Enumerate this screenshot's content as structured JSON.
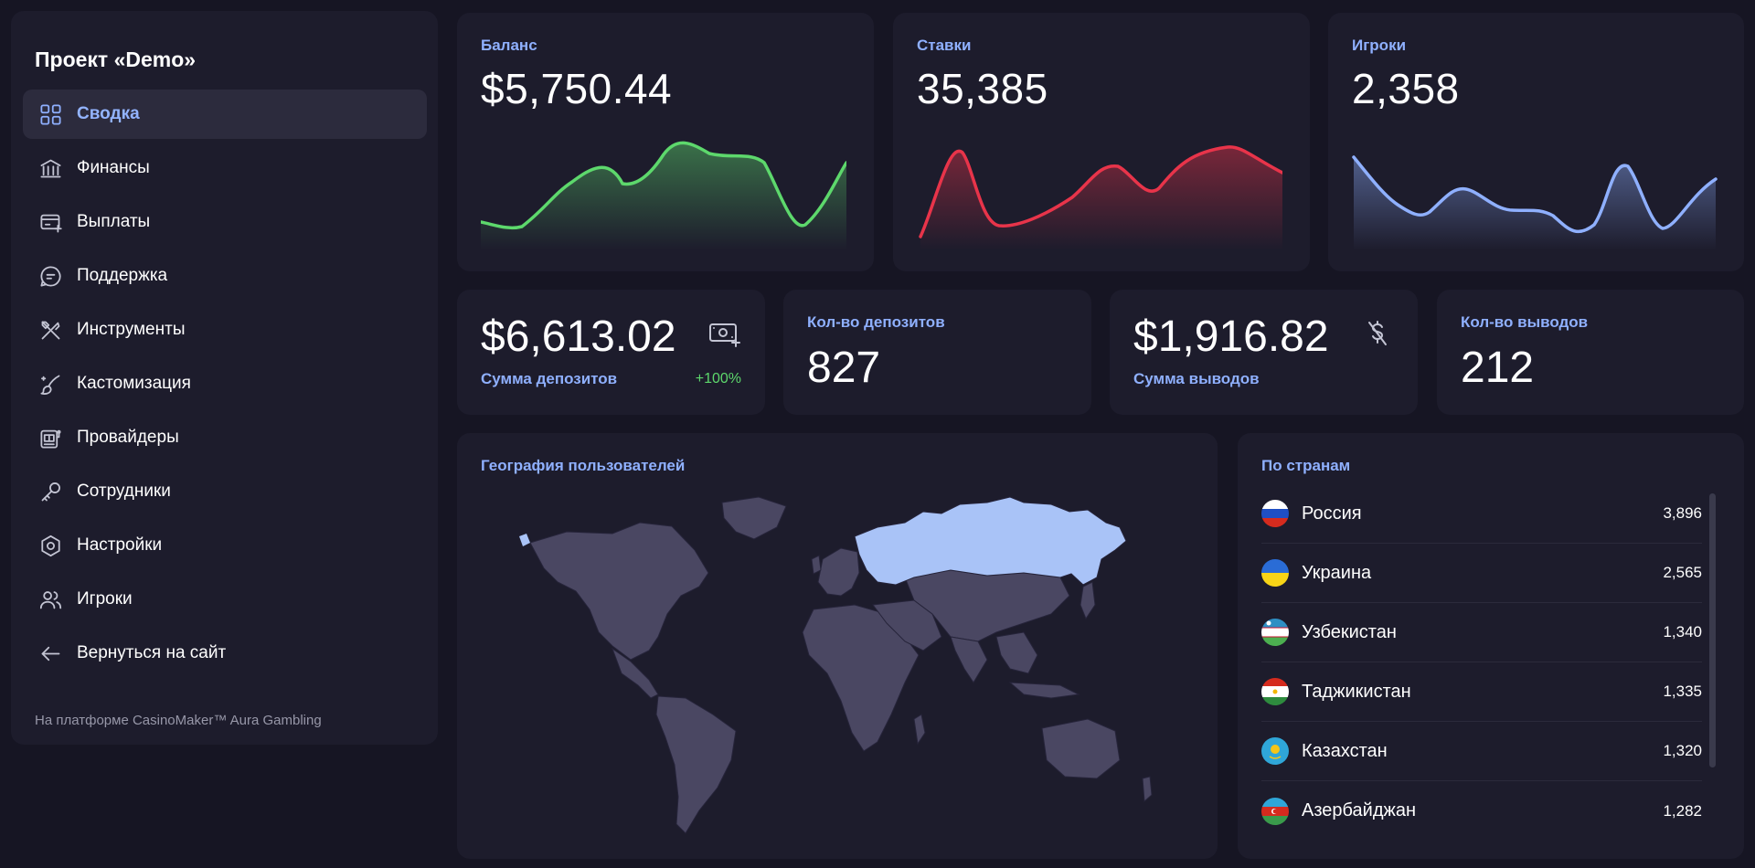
{
  "project_title": "Проект «Demo»",
  "nav": [
    {
      "label": "Сводка",
      "icon": "dashboard-icon",
      "active": true
    },
    {
      "label": "Финансы",
      "icon": "bank-icon"
    },
    {
      "label": "Выплаты",
      "icon": "payout-icon"
    },
    {
      "label": "Поддержка",
      "icon": "chat-icon"
    },
    {
      "label": "Инструменты",
      "icon": "tools-icon"
    },
    {
      "label": "Кастомизация",
      "icon": "brush-icon"
    },
    {
      "label": "Провайдеры",
      "icon": "slot-machine-icon"
    },
    {
      "label": "Сотрудники",
      "icon": "key-icon"
    },
    {
      "label": "Настройки",
      "icon": "gear-icon"
    },
    {
      "label": "Игроки",
      "icon": "users-icon"
    },
    {
      "label": "Вернуться на сайт",
      "icon": "arrow-left-icon"
    }
  ],
  "platform_note": "На платформе CasinoMaker™ Aura Gambling",
  "cards": {
    "balance": {
      "label": "Баланс",
      "value": "$5,750.44",
      "color": "#5dd86c"
    },
    "bets": {
      "label": "Ставки",
      "value": "35,385",
      "color": "#e8344a"
    },
    "players": {
      "label": "Игроки",
      "value": "2,358",
      "color": "#8fb0ff"
    }
  },
  "stats": {
    "deposits_sum": {
      "value": "$6,613.02",
      "label": "Сумма депозитов",
      "change": "+100%",
      "icon": "cash-plus-icon"
    },
    "deposits_count": {
      "label": "Кол-во депозитов",
      "value": "827"
    },
    "withdrawals_sum": {
      "value": "$1,916.82",
      "label": "Сумма выводов",
      "icon": "dollar-off-icon"
    },
    "withdrawals_count": {
      "label": "Кол-во выводов",
      "value": "212"
    }
  },
  "geography": {
    "title": "География пользователей"
  },
  "countries": {
    "title": "По странам",
    "items": [
      {
        "name": "Россия",
        "count": "3,896",
        "flag": "russia-flag-icon"
      },
      {
        "name": "Украина",
        "count": "2,565",
        "flag": "ukraine-flag-icon"
      },
      {
        "name": "Узбекистан",
        "count": "1,340",
        "flag": "uzbekistan-flag-icon"
      },
      {
        "name": "Таджикистан",
        "count": "1,335",
        "flag": "tajikistan-flag-icon"
      },
      {
        "name": "Казахстан",
        "count": "1,320",
        "flag": "kazakhstan-flag-icon"
      },
      {
        "name": "Азербайджан",
        "count": "1,282",
        "flag": "azerbaijan-flag-icon"
      }
    ]
  }
}
